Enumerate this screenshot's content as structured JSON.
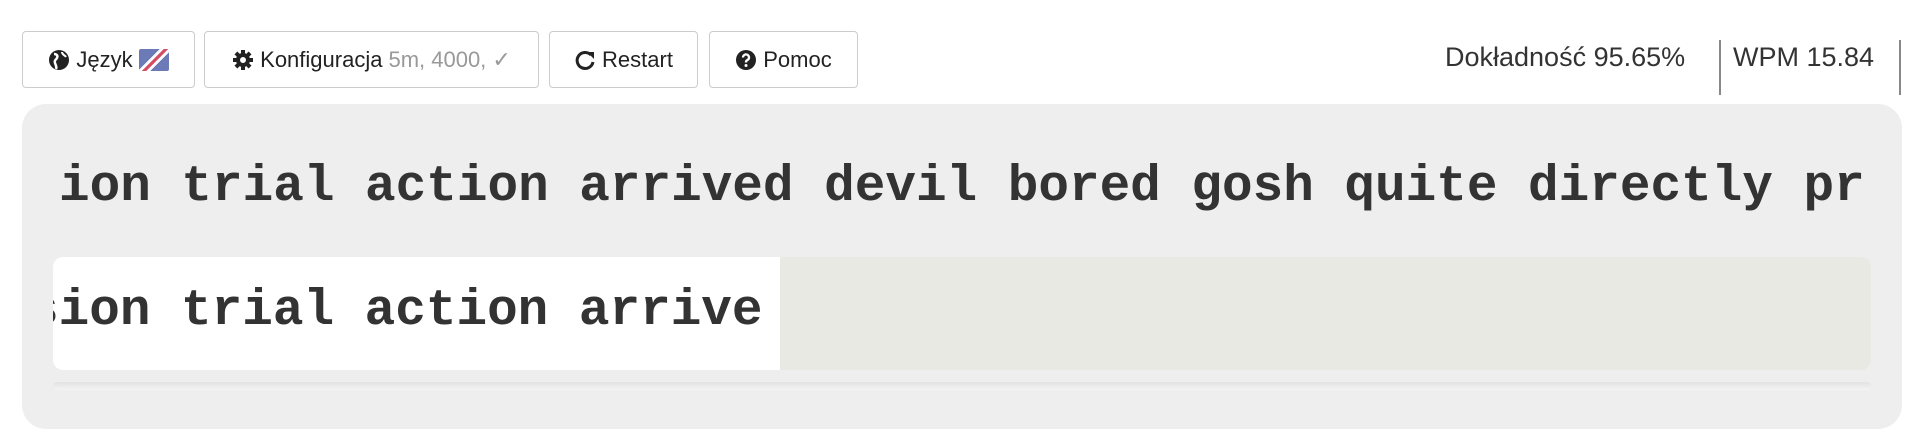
{
  "toolbar": {
    "language_label": "Język",
    "config_label": "Konfiguracja",
    "config_summary": "5m, 4000, ✓",
    "restart_label": "Restart",
    "help_label": "Pomoc"
  },
  "stats": {
    "accuracy": "Dokładność 95.65%",
    "wpm": "WPM 15.84"
  },
  "typing": {
    "target_text": "ion trial action arrived devil bored gosh quite directly pr",
    "typed_text": "sion trial action arrive"
  }
}
